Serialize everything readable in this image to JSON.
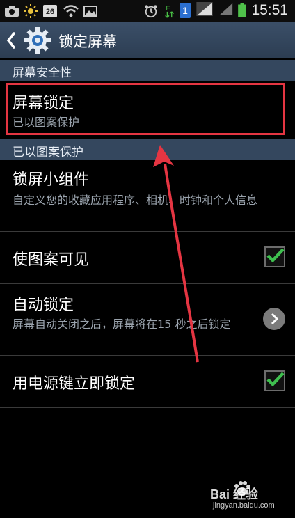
{
  "status_bar": {
    "calendar_day": "26",
    "sim_indicator": "1",
    "time": "15:51",
    "icons": [
      "camera-icon",
      "brightness-icon",
      "calendar-icon",
      "wifi-icon",
      "image-icon",
      "alarm-icon",
      "data-e-icon",
      "sim-icon",
      "signal-icon",
      "battery-icon"
    ]
  },
  "action_bar": {
    "title": "锁定屏幕",
    "back_icon": "chevron-left-icon",
    "app_icon": "gear-icon"
  },
  "sections": {
    "security": "屏幕安全性",
    "pattern": "已以图案保护"
  },
  "items": {
    "screen_lock": {
      "title": "屏幕锁定",
      "subtitle": "已以图案保护"
    },
    "lock_widget": {
      "title": "锁屏小组件",
      "subtitle": "自定义您的收藏应用程序、相机、时钟和个人信息"
    },
    "pattern_visible": {
      "title": "使图案可见",
      "checked": true
    },
    "auto_lock": {
      "title": "自动锁定",
      "subtitle": "屏幕自动关闭之后，屏幕将在15 秒之后锁定"
    },
    "power_lock": {
      "title": "用电源键立即锁定",
      "checked": true
    }
  },
  "watermark": {
    "brand": "Bai 经验",
    "url": "jingyan.baidu.com"
  },
  "colors": {
    "highlight": "#e53542",
    "check": "#3fbf4f",
    "header": "#34475e"
  }
}
